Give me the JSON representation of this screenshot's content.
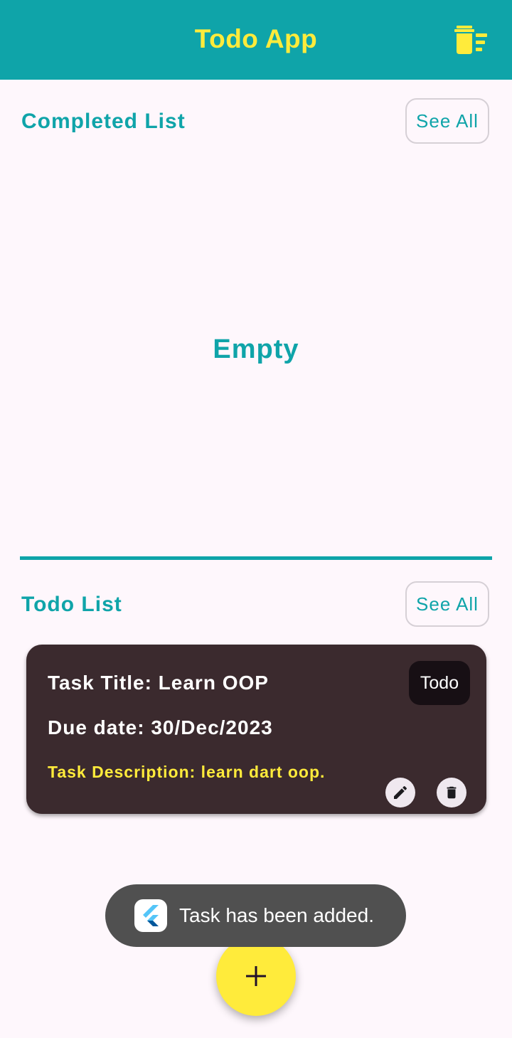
{
  "app_bar": {
    "title": "Todo App",
    "clear_icon": "delete-sweep-icon",
    "background_color": "#0fa4a9",
    "title_color": "#ffeb3b"
  },
  "completed_section": {
    "title": "Completed List",
    "see_all_label": "See All",
    "empty_text": "Empty"
  },
  "todo_section": {
    "title": "Todo List",
    "see_all_label": "See All",
    "tasks": [
      {
        "title": "Task Title: Learn OOP",
        "due_date": "Due date: 30/Dec/2023",
        "description": "Task Description: learn dart oop.",
        "status": "Todo",
        "edit_icon": "pencil-icon",
        "delete_icon": "trash-icon"
      }
    ]
  },
  "fab": {
    "icon": "plus-icon",
    "color": "#ffeb3b"
  },
  "toast": {
    "message": "Task has been added.",
    "icon": "flutter-logo-icon"
  }
}
